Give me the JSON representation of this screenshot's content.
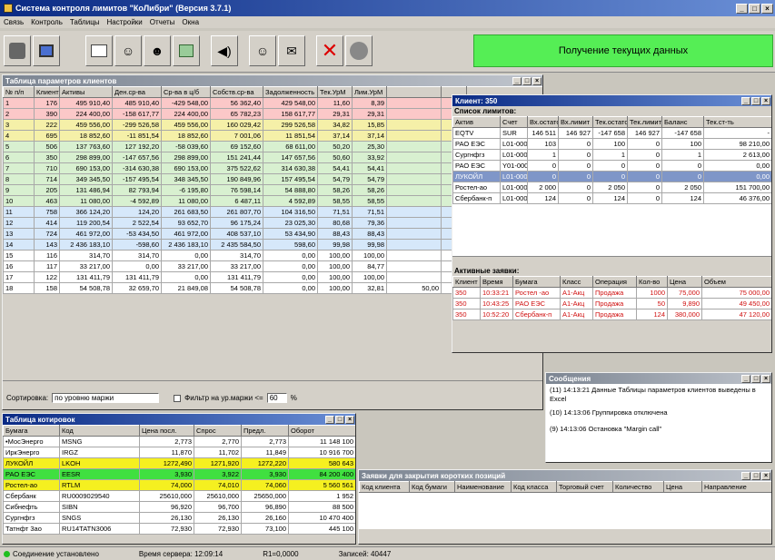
{
  "app": {
    "title": "Система контроля лимитов \"КоЛибри\" (Версия 3.7.1)",
    "menu": [
      "Связь",
      "Контроль",
      "Таблицы",
      "Настройки",
      "Отчеты",
      "Окна"
    ],
    "status_message": "Получение текущих данных"
  },
  "params_table": {
    "title": "Таблица параметров клиентов",
    "headers": [
      "№ п/п",
      "Клиент",
      "Активы",
      "Ден.ср-ва",
      "Ср-ва в ц/б",
      "Собств.ср-ва",
      "Задолженность",
      "Тек.УрМ",
      "Лим.УрМ"
    ],
    "rows": [
      [
        "1",
        "176",
        "495 910,40",
        "485 910,40",
        "-429 548,00",
        "56 362,40",
        "429 548,00",
        "11,60",
        "8,39"
      ],
      [
        "2",
        "390",
        "224 400,00",
        "-158 617,77",
        "224 400,00",
        "65 782,23",
        "158 617,77",
        "29,31",
        "29,31"
      ],
      [
        "3",
        "222",
        "459 556,00",
        "-299 526,58",
        "459 556,00",
        "160 029,42",
        "299 526,58",
        "34,82",
        "15,85"
      ],
      [
        "4",
        "695",
        "18 852,60",
        "-11 851,54",
        "18 852,60",
        "7 001,06",
        "11 851,54",
        "37,14",
        "37,14"
      ],
      [
        "5",
        "506",
        "137 763,60",
        "127 192,20",
        "-58 039,60",
        "69 152,60",
        "68 611,00",
        "50,20",
        "25,30"
      ],
      [
        "6",
        "350",
        "298 899,00",
        "-147 657,56",
        "298 899,00",
        "151 241,44",
        "147 657,56",
        "50,60",
        "33,92"
      ],
      [
        "7",
        "710",
        "690 153,00",
        "-314 630,38",
        "690 153,00",
        "375 522,62",
        "314 630,38",
        "54,41",
        "54,41"
      ],
      [
        "8",
        "714",
        "349 345,50",
        "-157 495,54",
        "348 345,50",
        "190 849,96",
        "157 495,54",
        "54,79",
        "54,79"
      ],
      [
        "9",
        "205",
        "131 486,94",
        "82 793,94",
        "-6 195,80",
        "76 598,14",
        "54 888,80",
        "58,26",
        "58,26"
      ],
      [
        "10",
        "463",
        "11 080,00",
        "-4 592,89",
        "11 080,00",
        "6 487,11",
        "4 592,89",
        "58,55",
        "58,55"
      ],
      [
        "11",
        "758",
        "366 124,20",
        "124,20",
        "261 683,50",
        "261 807,70",
        "104 316,50",
        "71,51",
        "71,51"
      ],
      [
        "12",
        "414",
        "119 200,54",
        "2 522,54",
        "93 652,70",
        "96 175,24",
        "23 025,30",
        "80,68",
        "79,36"
      ],
      [
        "13",
        "724",
        "461 972,00",
        "-53 434,50",
        "461 972,00",
        "408 537,10",
        "53 434,90",
        "88,43",
        "88,43"
      ],
      [
        "14",
        "143",
        "2 436 183,10",
        "-598,60",
        "2 436 183,10",
        "2 435 584,50",
        "598,60",
        "99,98",
        "99,98"
      ],
      [
        "15",
        "116",
        "314,70",
        "314,70",
        "0,00",
        "314,70",
        "0,00",
        "100,00",
        "100,00"
      ],
      [
        "16",
        "117",
        "33 217,00",
        "0,00",
        "33 217,00",
        "33 217,00",
        "0,00",
        "100,00",
        "84,77"
      ],
      [
        "17",
        "122",
        "131 411,79",
        "131 411,79",
        "0,00",
        "131 411,79",
        "0,00",
        "100,00",
        "100,00"
      ],
      [
        "18",
        "158",
        "54 508,78",
        "32 659,70",
        "21 849,08",
        "54 508,78",
        "0,00",
        "100,00",
        "32,81"
      ]
    ],
    "extra_col": "50,00",
    "extra_col2": "0,00",
    "sort_label": "Сортировка:",
    "sort_value": "по уровню маржи",
    "filter_label": "Фильтр на ур.маржи <=",
    "filter_value": "60",
    "filter_unit": "%"
  },
  "quotes_table": {
    "title": "Таблица котировок",
    "headers": [
      "Бумага",
      "Код",
      "Цена посл.",
      "Спрос",
      "Предл.",
      "Оборот"
    ],
    "rows": [
      [
        "•МосЭнерго",
        "MSNG",
        "2,773",
        "2,770",
        "2,773",
        "11 148 100"
      ],
      [
        "ИркЭнерго",
        "IRGZ",
        "11,870",
        "11,702",
        "11,849",
        "10 916 700"
      ],
      [
        "ЛУКОЙЛ",
        "LKOH",
        "1272,490",
        "1271,920",
        "1272,220",
        "580 643"
      ],
      [
        "РАО ЕЭС",
        "EESR",
        "3,930",
        "3,922",
        "3,930",
        "84 200 400"
      ],
      [
        "Ростел-ао",
        "RTLM",
        "74,000",
        "74,010",
        "74,060",
        "5 560 561"
      ],
      [
        "Сбербанк",
        "RU0009029540",
        "25610,000",
        "25610,000",
        "25650,000",
        "1 952"
      ],
      [
        "Сибнефть",
        "SIBN",
        "96,920",
        "96,700",
        "96,890",
        "88 500"
      ],
      [
        "Сургнфгз",
        "SNGS",
        "26,130",
        "26,130",
        "26,160",
        "10 470 400"
      ],
      [
        "Татнфт 3ао",
        "RU14TATN3006",
        "72,930",
        "72,930",
        "73,100",
        "445 100"
      ]
    ]
  },
  "client_win": {
    "title": "Клиент: 350",
    "limits_label": "Список лимитов:",
    "headers": [
      "Актив",
      "Счет",
      "Вх.остаток",
      "Вх.лимит",
      "Тек.остаток",
      "Тек.лимит",
      "Баланс",
      "Тек.ст-ть"
    ],
    "rows": [
      [
        "EQTV",
        "SUR",
        "146 511",
        "146 927",
        "-147 658",
        "146 927",
        "-147 658",
        "-"
      ],
      [
        "РАО ЕЭС",
        "L01-0000",
        "103",
        "0",
        "100",
        "0",
        "100",
        "98 210,00"
      ],
      [
        "Сургнфгз",
        "L01-0000",
        "1",
        "0",
        "1",
        "0",
        "1",
        "2 613,00"
      ],
      [
        "РАО ЕЭС",
        "Y01-0000",
        "0",
        "0",
        "0",
        "0",
        "0",
        "0,00"
      ],
      [
        "ЛУКОЙЛ",
        "L01-0000",
        "0",
        "0",
        "0",
        "0",
        "0",
        "0,00"
      ],
      [
        "Ростел-ао",
        "L01-0000",
        "2 000",
        "0",
        "2 050",
        "0",
        "2 050",
        "151 700,00"
      ],
      [
        "Сбербанк-п",
        "L01-0000",
        "124",
        "0",
        "124",
        "0",
        "124",
        "46 376,00"
      ]
    ],
    "orders_label": "Активные заявки:",
    "orders_headers": [
      "Клиент",
      "Время",
      "Бумага",
      "Класс",
      "Операция",
      "Кол-во",
      "Цена",
      "Объем"
    ],
    "orders": [
      [
        "350",
        "10:33:21",
        "Ростел -ао",
        "A1-Акц",
        "Продажа",
        "1000",
        "75,000",
        "75 000,00"
      ],
      [
        "350",
        "10:43:25",
        "РАО ЕЭС",
        "A1-Акц",
        "Продажа",
        "50",
        "9,890",
        "49 450,00"
      ],
      [
        "350",
        "10:52:20",
        "Сбербанк-п",
        "A1-Акц",
        "Продажа",
        "124",
        "380,000",
        "47 120,00"
      ]
    ]
  },
  "messages": {
    "title": "Сообщения",
    "items": [
      "(11) 14:13:21  Данные Таблицы параметров клиентов выведены в Excel",
      "(10) 14:13:06  Группировка отключена",
      "(9) 14:13:06  Остановка \"Margin call\""
    ]
  },
  "short_win": {
    "title": "Заявки для закрытия коротких позиций",
    "headers": [
      "Код клиента",
      "Код бумаги",
      "Наименование",
      "Код класса",
      "Торговый счет",
      "Количество",
      "Цена",
      "Направление"
    ]
  },
  "statusbar": {
    "conn": "Соединение установлено",
    "time": "Время сервера: 12:09:14",
    "r1": "R1=0,0000",
    "count": "Записей: 40447"
  }
}
